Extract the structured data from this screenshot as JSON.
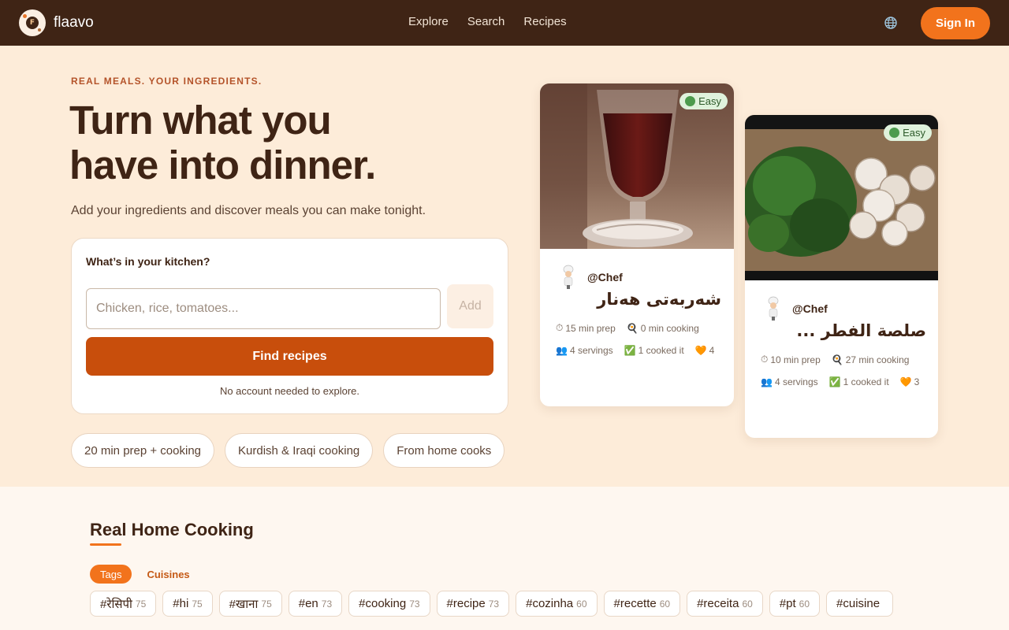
{
  "nav": {
    "brand": "flaavo",
    "logo_letter": "F",
    "links": [
      "Explore",
      "Search",
      "Recipes"
    ],
    "sign_in": "Sign In"
  },
  "hero": {
    "eyebrow": "REAL MEALS. YOUR INGREDIENTS.",
    "headline_line1": "Turn what you",
    "headline_line2": "have into dinner.",
    "subhead": "Add your ingredients and discover meals you can make tonight.",
    "kitchen_label": "What’s in your kitchen?",
    "input_placeholder": "Chicken, rice, tomatoes...",
    "add_label": "Add",
    "find_label": "Find recipes",
    "note": "No account needed to explore.",
    "chips": [
      "20 min prep + cooking",
      "Kurdish & Iraqi cooking",
      "From home cooks"
    ]
  },
  "cards": [
    {
      "badge": "Easy",
      "author": "@Chef",
      "title": "شەربەتی هەنار",
      "prep": "15 min prep",
      "cooking": "0 min cooking",
      "servings": "4 servings",
      "cooked": "1 cooked it",
      "likes": "4"
    },
    {
      "badge": "Easy",
      "author": "@Chef",
      "title": "صلصة الفطر ...",
      "prep": "10 min prep",
      "cooking": "27 min cooking",
      "servings": "4 servings",
      "cooked": "1 cooked it",
      "likes": "3"
    }
  ],
  "section": {
    "title": "Real Home Cooking",
    "tabs": [
      "Tags",
      "Cuisines"
    ],
    "tags": [
      {
        "name": "#रेसिपी",
        "count": "75"
      },
      {
        "name": "#hi",
        "count": "75"
      },
      {
        "name": "#खाना",
        "count": "75"
      },
      {
        "name": "#en",
        "count": "73"
      },
      {
        "name": "#cooking",
        "count": "73"
      },
      {
        "name": "#recipe",
        "count": "73"
      },
      {
        "name": "#cozinha",
        "count": "60"
      },
      {
        "name": "#recette",
        "count": "60"
      },
      {
        "name": "#receita",
        "count": "60"
      },
      {
        "name": "#pt",
        "count": "60"
      },
      {
        "name": "#cuisine",
        "count": ""
      }
    ]
  },
  "colors": {
    "nav_bg": "#3f2415",
    "accent": "#f2731c",
    "primary_button": "#c84e0c",
    "hero_bg": "#fdecd9",
    "easy_badge": "#dff2dc"
  }
}
